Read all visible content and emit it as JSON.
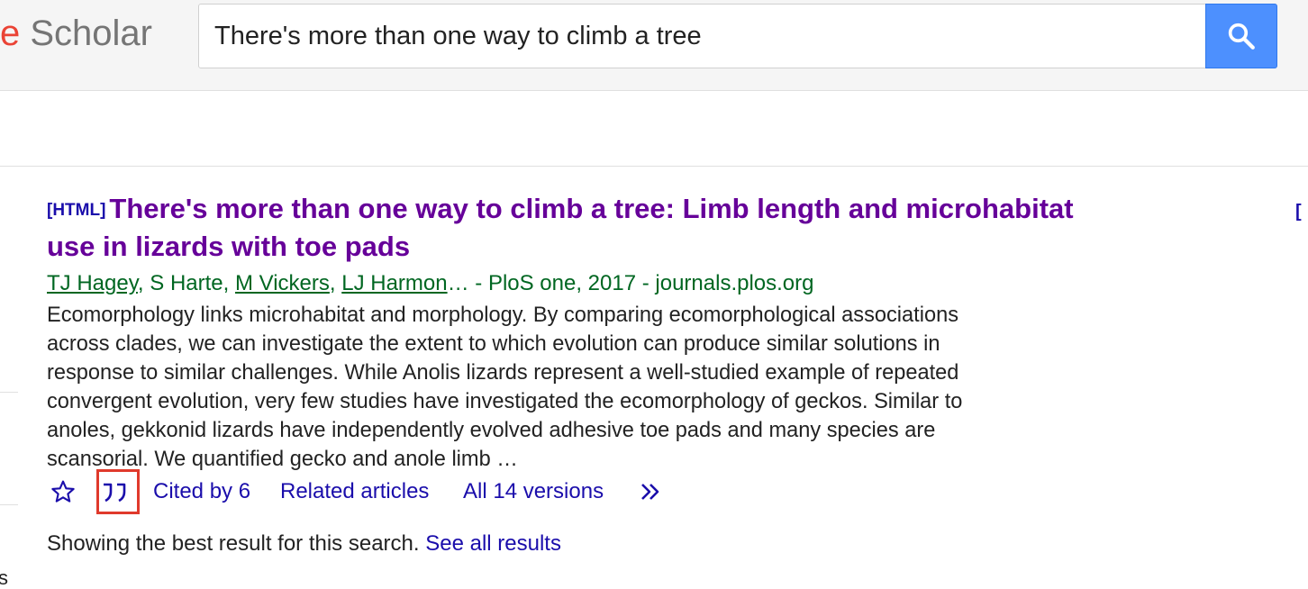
{
  "header": {
    "logo_fragment": "e",
    "logo_text": "Scholar",
    "search_value": "There's more than one way to climb a tree",
    "search_button_icon": "search-icon"
  },
  "result": {
    "format_tag": "[HTML]",
    "title": "There's more than one way to climb a tree: Limb length and microhabitat use in lizards with toe pads",
    "authors": [
      {
        "name": "TJ Hagey",
        "linked": true
      },
      {
        "name": "S Harte",
        "linked": false
      },
      {
        "name": "M Vickers",
        "linked": true
      },
      {
        "name": "LJ Harmon",
        "linked": true
      }
    ],
    "author_sep": ", ",
    "source_suffix": "… - PloS one, 2017 - journals.plos.org",
    "snippet": "Ecomorphology links microhabitat and morphology. By comparing ecomorphological associations across clades, we can investigate the extent to which evolution can produce similar solutions in response to similar challenges. While Anolis lizards represent a well-studied example of repeated convergent evolution, very few studies have investigated the ecomorphology of geckos. Similar to anoles, gekkonid lizards have independently evolved adhesive toe pads and many species are scansorial. We quantified gecko and anole limb …",
    "actions": {
      "save_icon": "star-icon",
      "cite_icon": "quote-icon",
      "cited_by": "Cited by 6",
      "related": "Related articles",
      "versions": "All 14 versions",
      "more_icon": "double-chevron-right-icon"
    }
  },
  "footer": {
    "showing_text": "Showing the best result for this search.",
    "see_all": "See all results"
  },
  "edge_fragments": {
    "left": "s",
    "right": "["
  },
  "colors": {
    "link_blue": "#1a0dab",
    "visited_purple": "#660099",
    "author_green": "#006621",
    "search_button_blue": "#4d90fe",
    "highlight_red": "#e03a2c"
  }
}
